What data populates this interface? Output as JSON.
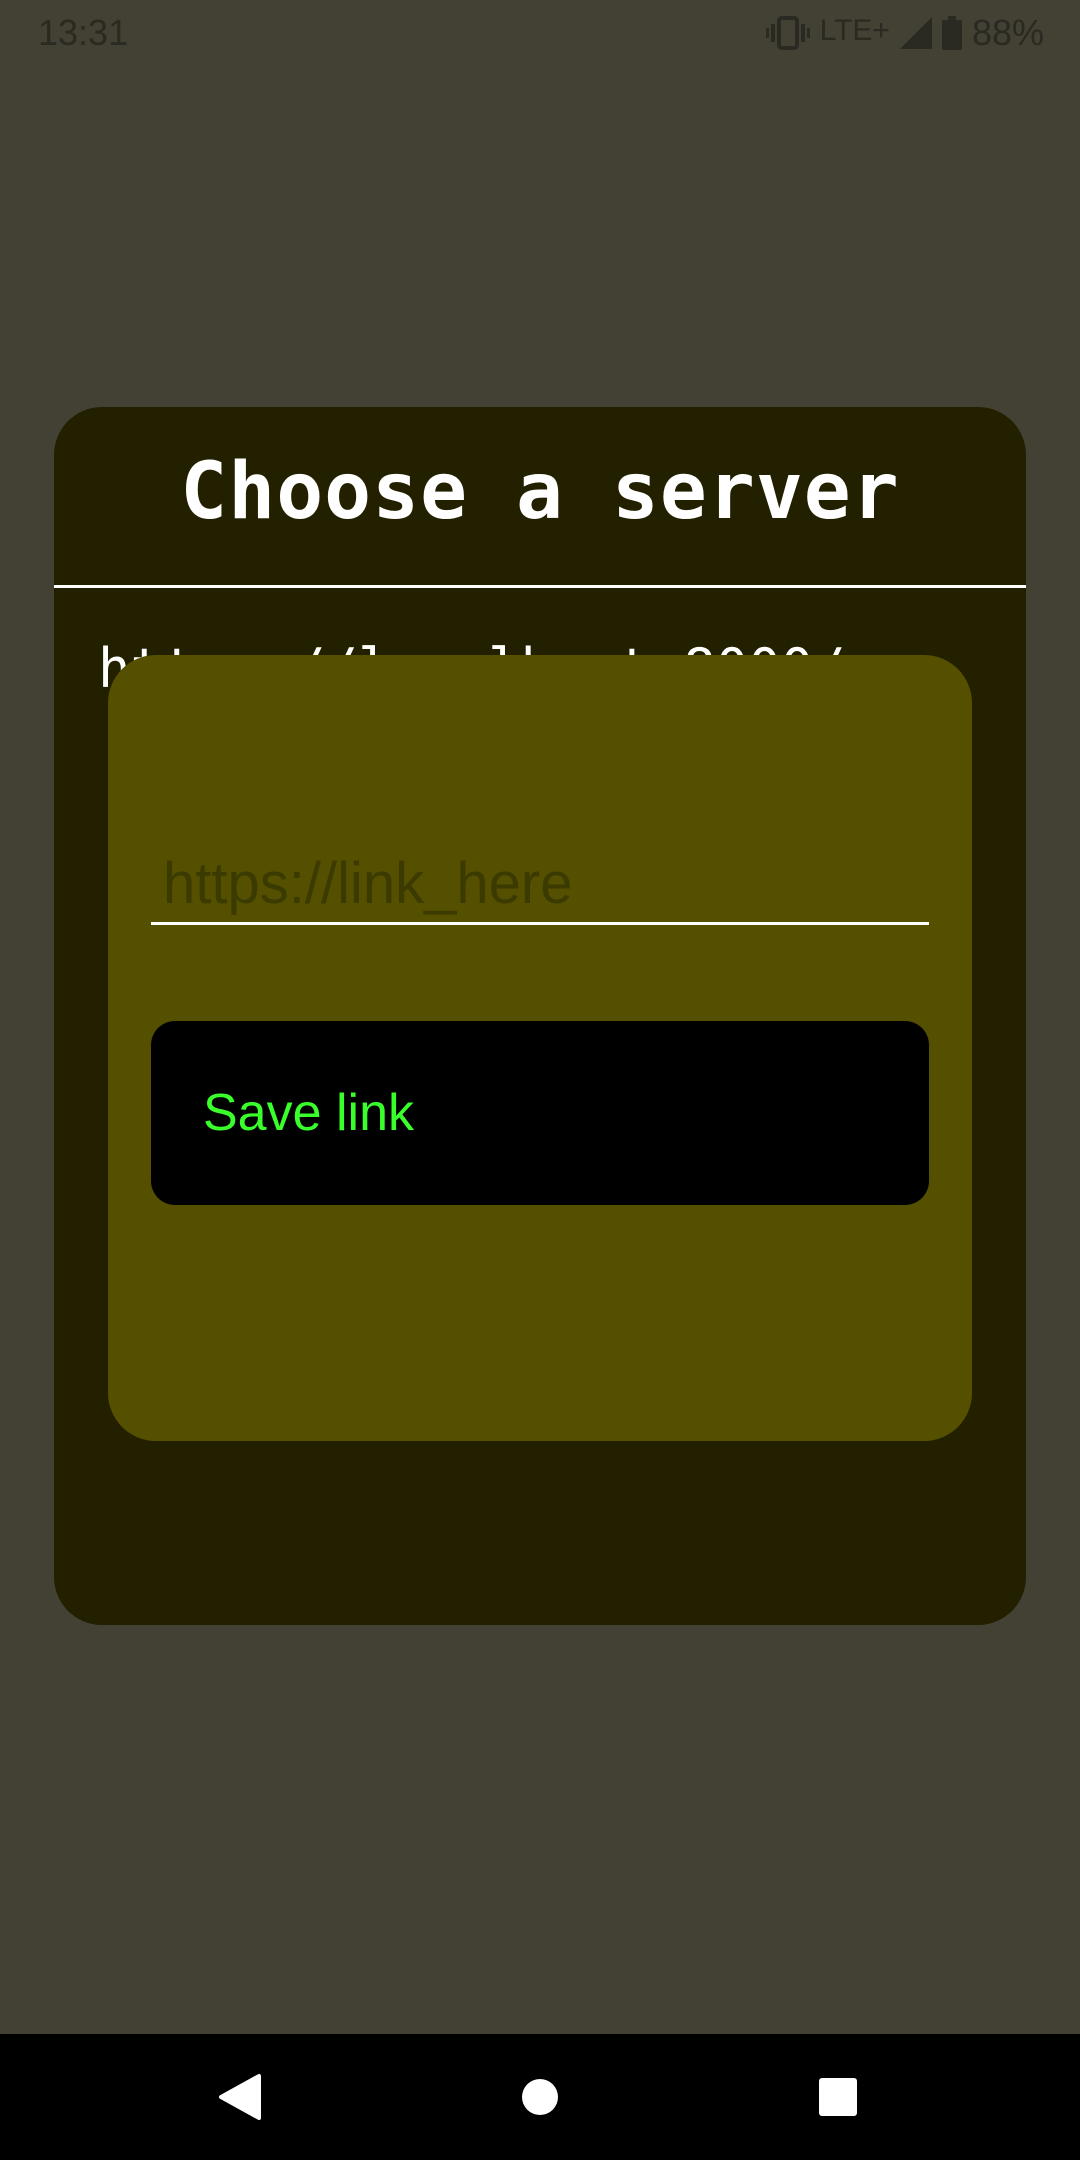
{
  "status_bar": {
    "time": "13:31",
    "network": "LTE+",
    "battery": "88%",
    "icons": [
      "vibrate-icon",
      "signal-icon",
      "battery-icon"
    ]
  },
  "server_dialog": {
    "title": "Choose a server",
    "server_link": "https://localhost:8000/"
  },
  "add_link_popup": {
    "input_placeholder": "https://link_here",
    "input_value": "",
    "save_label": "Save link"
  },
  "nav_bar": {
    "icons": [
      "back-icon",
      "home-icon",
      "recents-icon"
    ]
  },
  "colors": {
    "background": "#434034",
    "dialog": "#232000",
    "popup": "#554f00",
    "button": "#000000",
    "button_text": "#39ff2a"
  }
}
